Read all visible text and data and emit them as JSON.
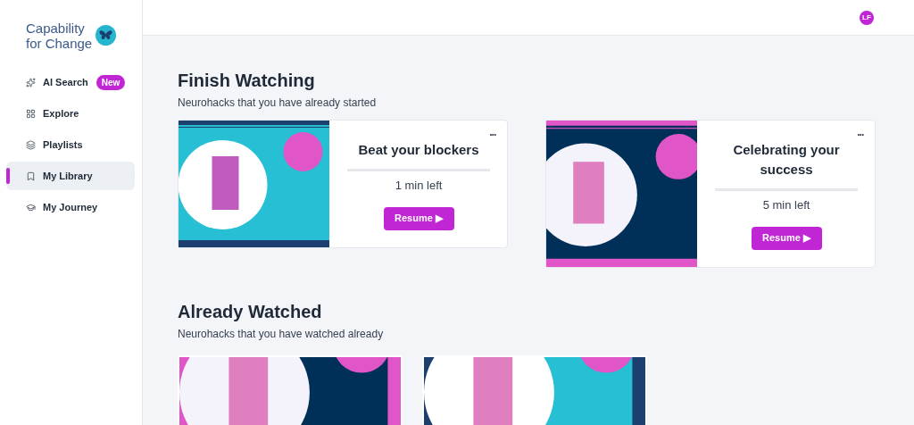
{
  "logo": {
    "line_1": "Capability",
    "line_2": "for Change"
  },
  "sidebar": {
    "items": [
      {
        "label": "AI Search",
        "badge": "New",
        "selected": false
      },
      {
        "label": "Explore",
        "selected": false
      },
      {
        "label": "Playlists",
        "selected": false
      },
      {
        "label": "My Library",
        "selected": true
      },
      {
        "label": "My Journey",
        "selected": false
      }
    ]
  },
  "header": {
    "avatar": "LF"
  },
  "finish_watching": {
    "title": "Finish Watching",
    "subtitle": "Neurohacks that you have already started",
    "cards": [
      {
        "title": "Beat your blockers",
        "time_left": "1 min left",
        "button": "Resume ▶",
        "menu": "•••"
      },
      {
        "title": "Celebrating your success",
        "time_left": "5 min left",
        "button": "Resume ▶",
        "menu": "•••"
      }
    ]
  },
  "already_watched": {
    "title": "Already Watched",
    "subtitle": "Neurohacks that you have watched already"
  }
}
